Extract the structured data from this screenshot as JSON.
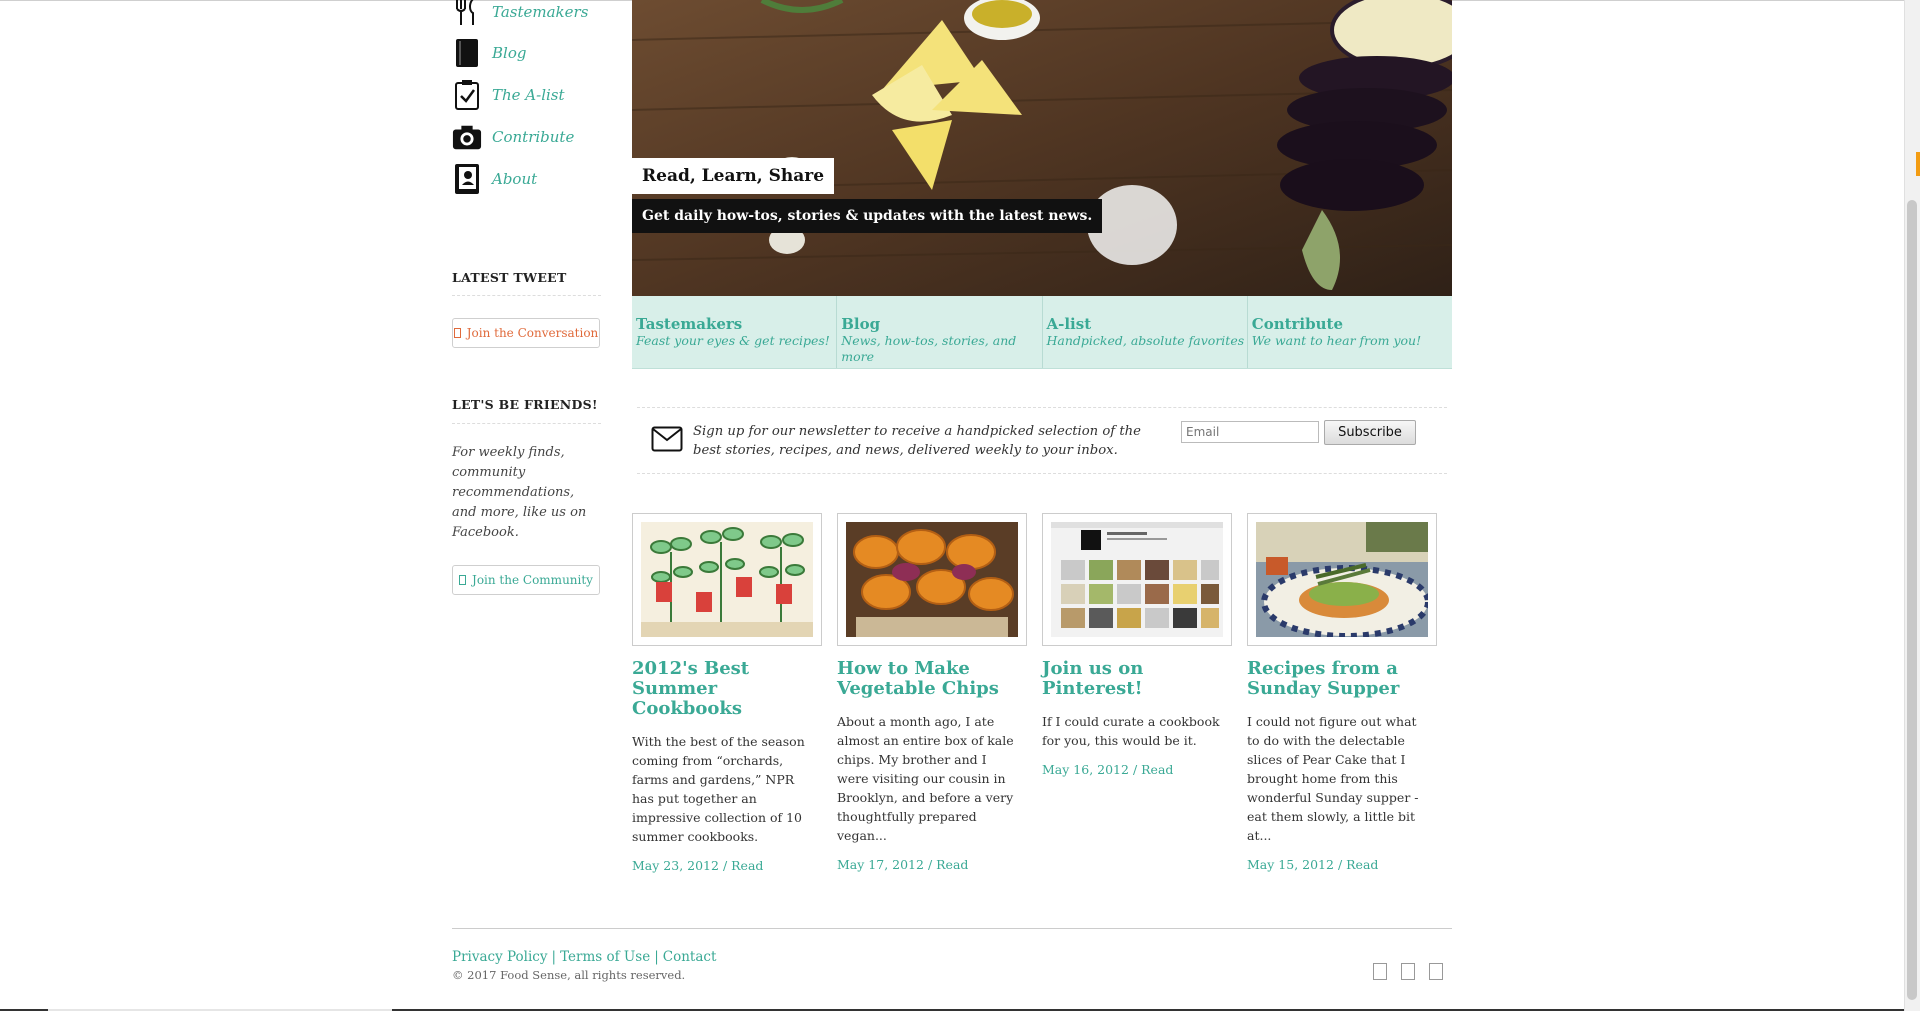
{
  "sidebar": {
    "nav": [
      {
        "label": "Tastemakers",
        "icon": "utensils-icon"
      },
      {
        "label": "Blog",
        "icon": "book-icon"
      },
      {
        "label": "The A-list",
        "icon": "checklist-icon"
      },
      {
        "label": "Contribute",
        "icon": "camera-icon"
      },
      {
        "label": "About",
        "icon": "profile-book-icon"
      }
    ],
    "latest_tweet_heading": "LATEST TWEET",
    "tweet_button": "Join the Conversation",
    "friends_heading": "LET'S BE FRIENDS!",
    "friends_text": "For weekly finds, community recommendations, and more, like us on Facebook.",
    "community_button": "Join the Community"
  },
  "hero": {
    "title": "Read, Learn, Share",
    "subtitle": "Get daily how-tos, stories & updates with the latest news."
  },
  "features": [
    {
      "title": "Tastemakers",
      "sub": "Feast your eyes & get recipes!"
    },
    {
      "title": "Blog",
      "sub": "News, how-tos, stories, and more"
    },
    {
      "title": "A-list",
      "sub": "Handpicked, absolute favorites"
    },
    {
      "title": "Contribute",
      "sub": "We want to hear from you!"
    }
  ],
  "newsletter": {
    "text": "Sign up for our newsletter to receive a handpicked selection of the best stories, recipes, and news, delivered weekly to your inbox.",
    "email_placeholder": "Email",
    "button": "Subscribe"
  },
  "cards": [
    {
      "title": "2012's Best Summer Cookbooks",
      "excerpt": "With the best of the season coming from “orchards, farms and gardens,” NPR has put together an impressive collection of 10 summer cookbooks.",
      "date": "May 23, 2012",
      "sep": "/",
      "read": "Read"
    },
    {
      "title": "How to Make Vegetable Chips",
      "excerpt": "About a month ago, I ate almost an entire box of kale chips. My brother and I were visiting our cousin in Brooklyn, and before a very thoughtfully prepared vegan...",
      "date": "May 17, 2012",
      "sep": "/",
      "read": "Read"
    },
    {
      "title": "Join us on Pinterest!",
      "excerpt": "If I could curate a cookbook for you, this would be it.",
      "date": "May 16, 2012",
      "sep": "/",
      "read": "Read"
    },
    {
      "title": "Recipes from a Sunday Supper",
      "excerpt": "I could not figure out what to do with the delectable slices of Pear Cake that I brought home from this wonderful Sunday supper - eat them slowly, a little bit at...",
      "date": "May 15, 2012",
      "sep": "/",
      "read": "Read"
    }
  ],
  "footer": {
    "links": [
      "Privacy Policy",
      "Terms of Use",
      "Contact"
    ],
    "link_sep": "|",
    "copyright": "© 2017 Food Sense, all rights reserved."
  },
  "colors": {
    "accent_teal": "#3aa995",
    "tweet_orange": "#e06a3b",
    "feature_bg": "#d8efe9"
  }
}
